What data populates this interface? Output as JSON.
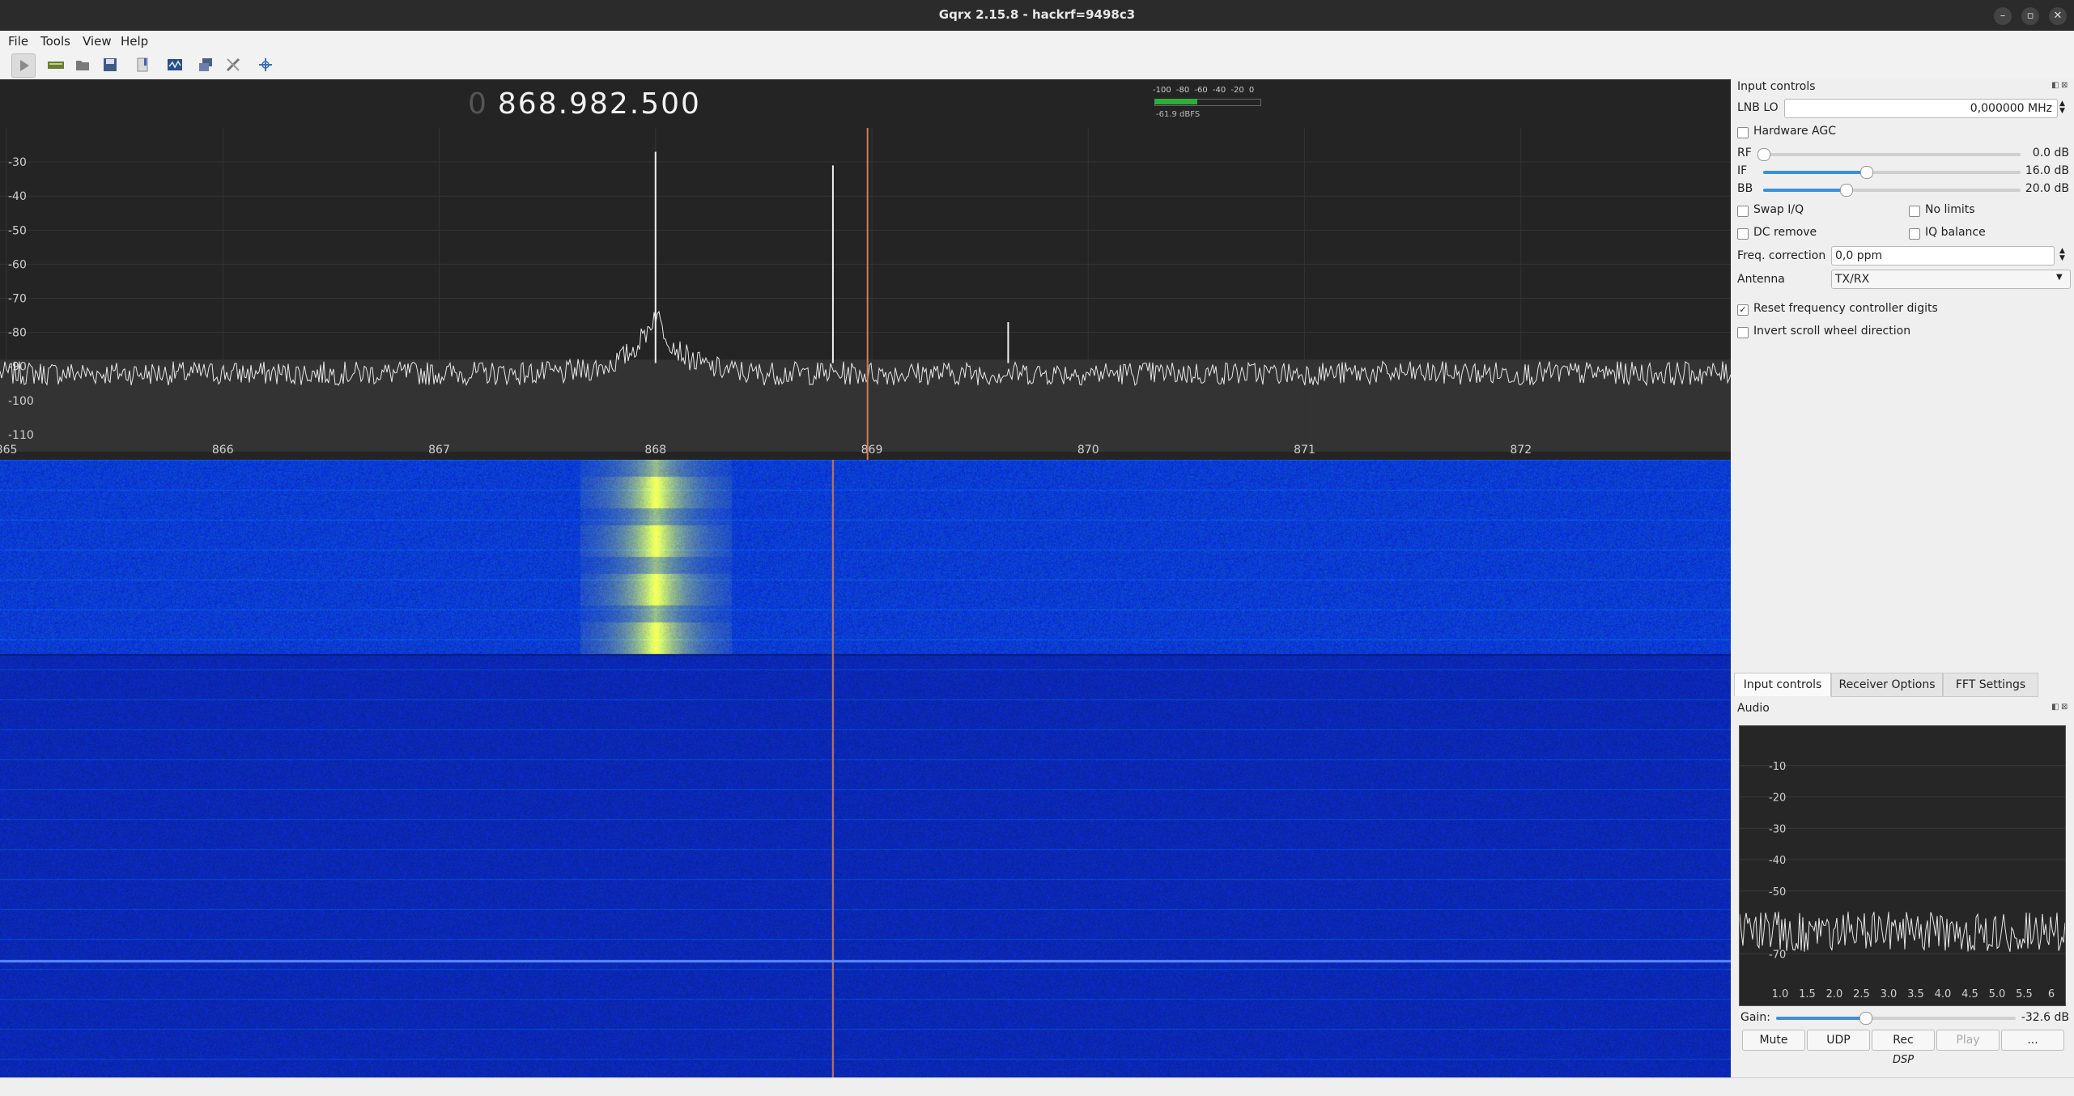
{
  "window": {
    "title": "Gqrx 2.15.8 - hackrf=9498c3",
    "btn_min": "–",
    "btn_max": "▫",
    "btn_close": "✕"
  },
  "menu": [
    "File",
    "Tools",
    "View",
    "Help"
  ],
  "toolbar_icons": [
    "play-icon",
    "hardware-icon",
    "open-icon",
    "save-icon",
    "bookmark-icon",
    "dsp-icon",
    "network-icon",
    "settings-icon",
    "center-icon"
  ],
  "frequency": {
    "leading": "0",
    "value": "868.982.500"
  },
  "meter": {
    "scale": "-100 -80 -60 -40 -20 0",
    "level": "-61.9 dBFS",
    "level_fraction": 0.41
  },
  "chart_data": {
    "type": "line",
    "title": "",
    "xlabel": "",
    "ylabel": "",
    "x_ticks": [
      "865",
      "866",
      "867",
      "868",
      "869",
      "870",
      "871",
      "872"
    ],
    "y_ticks": [
      "-30",
      "-40",
      "-50",
      "-60",
      "-70",
      "-80",
      "-90",
      "-100",
      "-110"
    ],
    "xlim": [
      864.97,
      872.97
    ],
    "ylim": [
      -115,
      -20
    ],
    "noise_floor": -92,
    "peaks": [
      {
        "freq": 868.0,
        "level": -27
      },
      {
        "freq": 868.82,
        "level": -31
      },
      {
        "freq": 869.63,
        "level": -77
      }
    ],
    "demod_marker_freq": 868.98
  },
  "input_controls": {
    "title": "Input controls",
    "lnb_label": "LNB LO",
    "lnb_value": "0,000000 MHz",
    "hw_agc": "Hardware AGC",
    "rf_label": "RF",
    "rf_value": "0.0 dB",
    "rf_fraction": 0.0,
    "if_label": "IF",
    "if_value": "16.0 dB",
    "if_fraction": 0.4,
    "bb_label": "BB",
    "bb_value": "20.0 dB",
    "bb_fraction": 0.32,
    "swap_iq": "Swap I/Q",
    "no_limits": "No limits",
    "dc_remove": "DC remove",
    "iq_balance": "IQ balance",
    "freq_corr_label": "Freq. correction",
    "freq_corr_value": "0,0 ppm",
    "antenna_label": "Antenna",
    "antenna_value": "TX/RX",
    "reset_digits": "Reset frequency controller digits",
    "invert_scroll": "Invert scroll wheel direction"
  },
  "tabs": [
    "Input controls",
    "Receiver Options",
    "FFT Settings"
  ],
  "audio": {
    "title": "Audio",
    "y_ticks": [
      "-10",
      "-20",
      "-30",
      "-40",
      "-50",
      "-70"
    ],
    "x_ticks": [
      "1.0",
      "1.5",
      "2.0",
      "2.5",
      "3.0",
      "3.5",
      "4.0",
      "4.5",
      "5.0",
      "5.5",
      "6"
    ],
    "gain_label": "Gain:",
    "gain_value": "-32.6 dB",
    "gain_fraction": 0.37,
    "buttons": [
      "Mute",
      "UDP",
      "Rec",
      "Play",
      "..."
    ],
    "dsp_label": "DSP"
  },
  "colors": {
    "waterfall_bg": "#0d1e9c",
    "spectrum_line": "#e8e8e8",
    "marker": "#d07a55",
    "accent": "#3d8fd8"
  }
}
